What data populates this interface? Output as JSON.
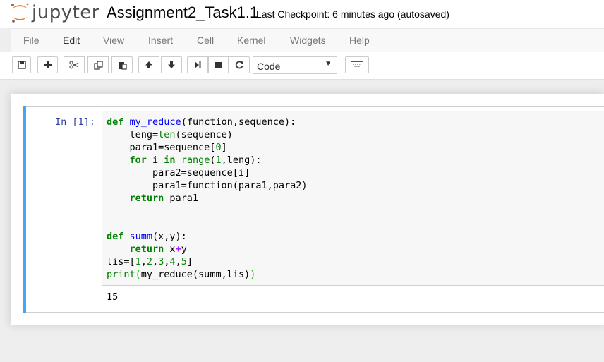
{
  "header": {
    "logo_text": "jupyter",
    "notebook_title": "Assignment2_Task1.1",
    "checkpoint": "Last Checkpoint: 6 minutes ago (autosaved)"
  },
  "menu": {
    "items": [
      "File",
      "Edit",
      "View",
      "Insert",
      "Cell",
      "Kernel",
      "Widgets",
      "Help"
    ]
  },
  "toolbar": {
    "buttons": [
      "save-icon",
      "plus-icon",
      "cut-icon",
      "copy-icon",
      "paste-icon",
      "arrow-up-icon",
      "arrow-down-icon",
      "run-icon",
      "stop-icon",
      "restart-icon",
      "keyboard-icon"
    ],
    "cell_type": "Code",
    "dropdown_arrow": "▼"
  },
  "cell": {
    "prompt": "In [1]:",
    "code_lines": [
      [
        [
          "kw",
          "def"
        ],
        [
          "",
          " "
        ],
        [
          "fn",
          "my_reduce"
        ],
        [
          "",
          "(function,sequence):"
        ]
      ],
      [
        [
          "",
          "    leng="
        ],
        [
          "bi",
          "len"
        ],
        [
          "",
          "(sequence)"
        ]
      ],
      [
        [
          "",
          "    para1=sequence["
        ],
        [
          "nm",
          "0"
        ],
        [
          "",
          "]"
        ]
      ],
      [
        [
          "",
          "    "
        ],
        [
          "kw",
          "for"
        ],
        [
          "",
          " i "
        ],
        [
          "kw",
          "in"
        ],
        [
          "",
          " "
        ],
        [
          "bi",
          "range"
        ],
        [
          "",
          "("
        ],
        [
          "nm",
          "1"
        ],
        [
          "",
          ",leng):"
        ]
      ],
      [
        [
          "",
          "        para2=sequence[i]"
        ]
      ],
      [
        [
          "",
          "        para1=function(para1,para2)"
        ]
      ],
      [
        [
          "",
          "    "
        ],
        [
          "kw",
          "return"
        ],
        [
          "",
          " para1"
        ]
      ],
      [
        [
          "",
          ""
        ]
      ],
      [
        [
          "",
          ""
        ]
      ],
      [
        [
          "kw",
          "def"
        ],
        [
          "",
          " "
        ],
        [
          "fn",
          "summ"
        ],
        [
          "",
          "(x,y):"
        ]
      ],
      [
        [
          "",
          "    "
        ],
        [
          "kw",
          "return"
        ],
        [
          "",
          " x"
        ],
        [
          "op",
          "+"
        ],
        [
          "",
          "y"
        ]
      ],
      [
        [
          "",
          "lis=["
        ],
        [
          "nm",
          "1"
        ],
        [
          "",
          ","
        ],
        [
          "nm",
          "2"
        ],
        [
          "",
          ","
        ],
        [
          "nm",
          "3"
        ],
        [
          "",
          ","
        ],
        [
          "nm",
          "4"
        ],
        [
          "",
          ","
        ],
        [
          "nm",
          "5"
        ],
        [
          "",
          "]"
        ]
      ],
      [
        [
          "bi",
          "print"
        ],
        [
          "pa",
          "("
        ],
        [
          "",
          "my_reduce(summ,lis)"
        ],
        [
          "pa",
          ")"
        ]
      ]
    ],
    "output": "15"
  }
}
